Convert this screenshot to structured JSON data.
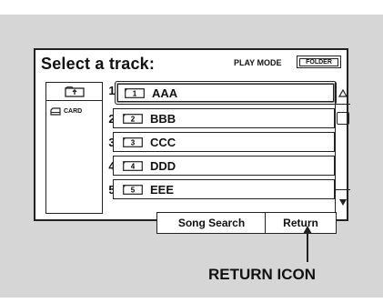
{
  "title": "Select a track:",
  "play_mode": {
    "label": "PLAY MODE",
    "button": "FOLDER"
  },
  "source": {
    "card_label": "CARD",
    "folder_up_icon": "folder-up-icon",
    "card_icon": "card-icon"
  },
  "tracks": [
    {
      "number": "1",
      "icon_number": "1",
      "name": "AAA",
      "selected": true
    },
    {
      "number": "2",
      "icon_number": "2",
      "name": "BBB"
    },
    {
      "number": "3",
      "icon_number": "3",
      "name": "CCC"
    },
    {
      "number": "4",
      "icon_number": "4",
      "name": "DDD"
    },
    {
      "number": "5",
      "icon_number": "5",
      "name": "EEE"
    }
  ],
  "scroll": {
    "up_icon": "triangle-up-icon",
    "down_icon": "triangle-down-icon"
  },
  "buttons": {
    "song_search": "Song Search",
    "return": "Return"
  },
  "callout": "RETURN ICON"
}
